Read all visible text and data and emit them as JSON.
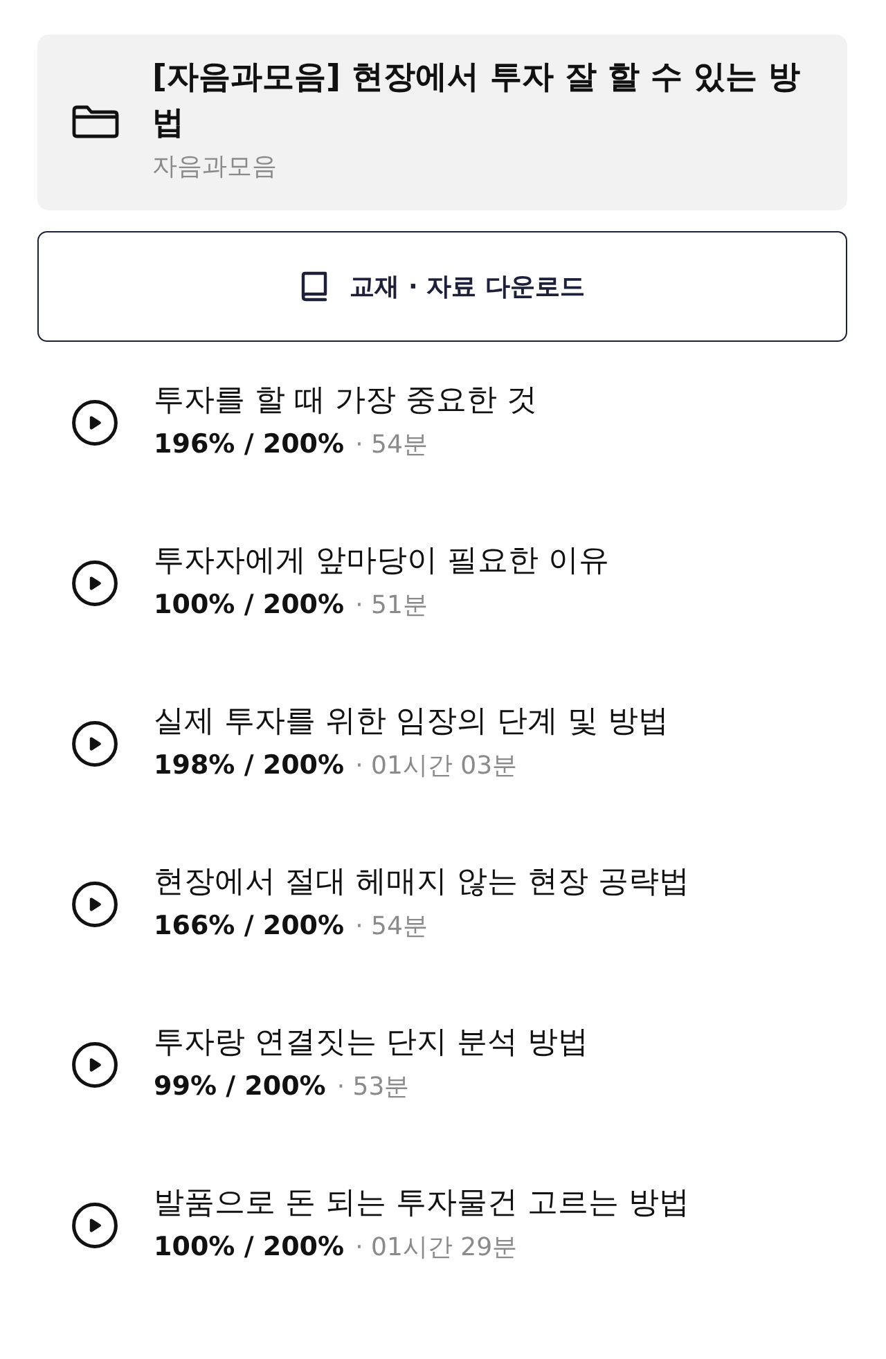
{
  "course": {
    "title": "[자음과모음] 현장에서 투자 잘 할 수 있는 방법",
    "author": "자음과모음"
  },
  "download_button": {
    "label": "교재 · 자료 다운로드"
  },
  "lessons": [
    {
      "title": "투자를 할 때 가장 중요한 것",
      "progress": "196% / 200%",
      "duration": "· 54분"
    },
    {
      "title": "투자자에게 앞마당이 필요한 이유",
      "progress": "100% / 200%",
      "duration": "· 51분"
    },
    {
      "title": "실제 투자를 위한 임장의 단계 및 방법",
      "progress": "198% / 200%",
      "duration": "· 01시간 03분"
    },
    {
      "title": "현장에서 절대 헤매지 않는 현장 공략법",
      "progress": "166% / 200%",
      "duration": "· 54분"
    },
    {
      "title": "투자랑 연결짓는 단지 분석 방법",
      "progress": "99% / 200%",
      "duration": "· 53분"
    },
    {
      "title": "발품으로 돈 되는 투자물건 고르는 방법",
      "progress": "100% / 200%",
      "duration": "· 01시간 29분"
    }
  ]
}
